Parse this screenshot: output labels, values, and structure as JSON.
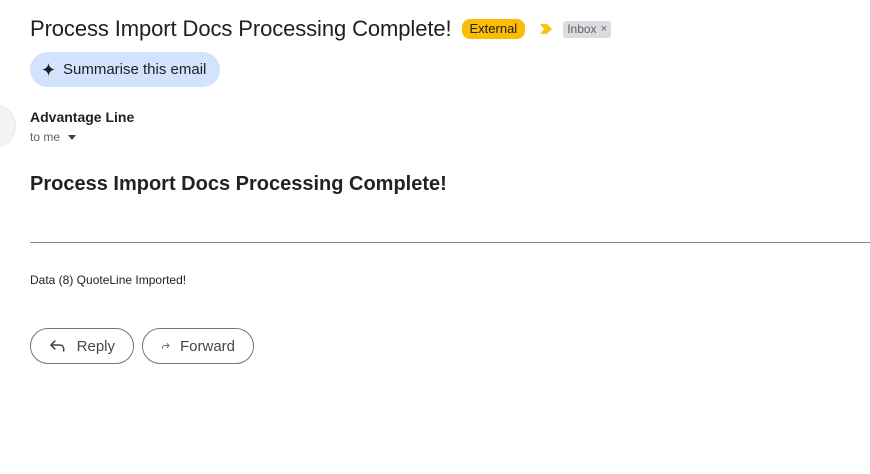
{
  "header": {
    "subject": "Process Import Docs Processing Complete!",
    "external_badge": "External",
    "label_chip": "Inbox",
    "label_remove": "×"
  },
  "summarise": {
    "label": "Summarise this email",
    "icon": "sparkle-icon"
  },
  "sender": {
    "name": "Advantage Line",
    "recipient": "to me"
  },
  "body": {
    "heading": "Process Import Docs Processing Complete!",
    "text": "Data (8) QuoteLine Imported!"
  },
  "actions": {
    "reply_label": "Reply",
    "forward_label": "Forward"
  },
  "colors": {
    "external_badge": "#fbbc04",
    "important_marker": "#f5c518",
    "summarise_bg": "#d3e3fd",
    "chip_bg": "#dadce0"
  }
}
